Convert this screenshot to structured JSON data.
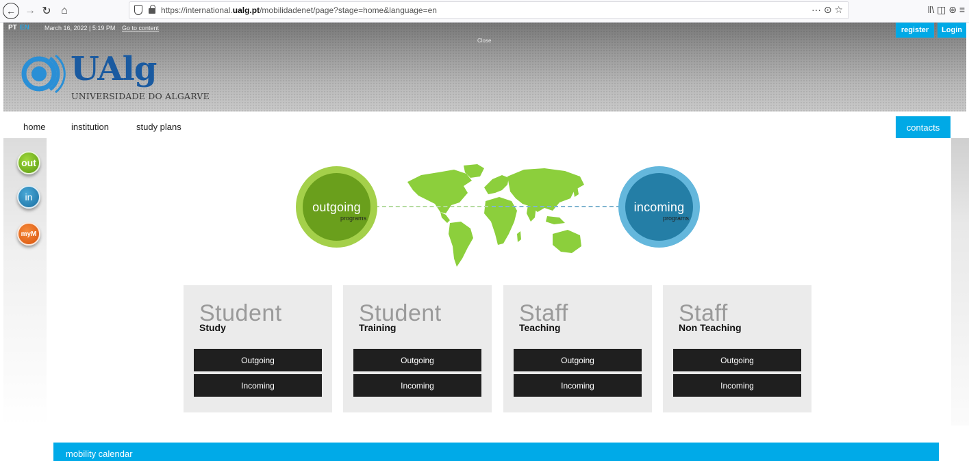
{
  "browser": {
    "url_prefix": "https://international.",
    "url_domain": "ualg.pt",
    "url_path": "/mobilidadenet/page?stage=home&language=en",
    "url_actions": "··· ⊙ ☆",
    "tools": "ǁ\\ ◫ ⊛ ≡"
  },
  "topbar": {
    "lang_pt": "PT",
    "lang_en": "EN",
    "datetime": "March 16, 2022 | 5:19 PM",
    "goto": "Go to content",
    "close": "Close",
    "register": "register",
    "login": "Login"
  },
  "logo": {
    "title": "UAlg",
    "subtitle": "UNIVERSIDADE DO ALGARVE"
  },
  "nav": {
    "home": "home",
    "institution": "institution",
    "study_plans": "study plans",
    "contacts": "contacts"
  },
  "side": {
    "out": "out",
    "in": "in",
    "my": "myM"
  },
  "programs": {
    "outgoing": "outgoing",
    "outgoing_sub": "programs",
    "incoming": "incoming",
    "incoming_sub": "programs"
  },
  "cards": [
    {
      "title": "Student",
      "subtitle": "Study",
      "outgoing": "Outgoing",
      "incoming": "Incoming"
    },
    {
      "title": "Student",
      "subtitle": "Training",
      "outgoing": "Outgoing",
      "incoming": "Incoming"
    },
    {
      "title": "Staff",
      "subtitle": "Teaching",
      "outgoing": "Outgoing",
      "incoming": "Incoming"
    },
    {
      "title": "Staff",
      "subtitle": "Non Teaching",
      "outgoing": "Outgoing",
      "incoming": "Incoming"
    }
  ],
  "calendar": {
    "label": "mobility calendar"
  },
  "colors": {
    "accent": "#00a9e6",
    "outgoing_green": "#6a9f1c",
    "incoming_blue": "#247ea6"
  }
}
